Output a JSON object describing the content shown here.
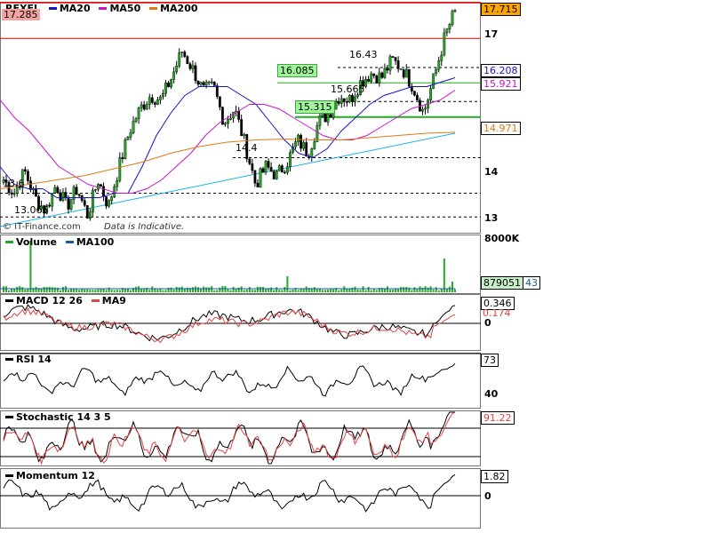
{
  "colors": {
    "ma20": "#1414c8",
    "ma50": "#c814c8",
    "ma200": "#e07814",
    "trendline": "#14b4e6",
    "support": "#22aa22",
    "resistance": "#dd0000",
    "candle_up": "#22aa22",
    "candle_down": "#000000",
    "volume": "#22aa22",
    "macd_signal": "#dd4444"
  },
  "main": {
    "symbol": "REXEL",
    "legend": [
      {
        "name": "MA20",
        "color": "#1414c8"
      },
      {
        "name": "MA50",
        "color": "#c814c8"
      },
      {
        "name": "MA200",
        "color": "#e07814"
      }
    ],
    "top_left_value": "17.285",
    "price_box": "17.715",
    "ma20_box": "16.208",
    "ma50_box": "15.921",
    "ma200_box": "14.971",
    "y_ticks": [
      "17",
      "16",
      "15",
      "14",
      "13"
    ],
    "levels": [
      {
        "text": "16.43",
        "value": 16.43
      },
      {
        "text": "16.085",
        "value": 16.085
      },
      {
        "text": "15.665",
        "value": 15.665
      },
      {
        "text": "15.315",
        "value": 15.315
      },
      {
        "text": "14.4",
        "value": 14.4
      },
      {
        "text": "13.6",
        "value": 13.6
      },
      {
        "text": "13.065",
        "value": 13.065
      }
    ],
    "watermark": "© IT-Finance.com",
    "disclaimer": "Data is Indicative."
  },
  "volume": {
    "legend": [
      {
        "name": "Volume",
        "color": "#22aa22"
      },
      {
        "name": "MA100",
        "color": "#1a5aa0"
      }
    ],
    "scale_label": "8000K",
    "value_box": "879051",
    "ma_box": "43"
  },
  "macd": {
    "legend": [
      {
        "name": "MACD 12 26",
        "color": "#000000"
      },
      {
        "name": "MA9",
        "color": "#dd4444"
      }
    ],
    "value_box": "0.346",
    "signal_box": "0.174",
    "zero_label": "0"
  },
  "rsi": {
    "legend": [
      {
        "name": "RSI 14",
        "color": "#000000"
      }
    ],
    "value_box": "73",
    "level_label": "40"
  },
  "stochastic": {
    "legend": [
      {
        "name": "Stochastic 14 3 5",
        "color": "#000000"
      }
    ],
    "value_box": "91.22"
  },
  "momentum": {
    "legend": [
      {
        "name": "Momentum 12",
        "color": "#000000"
      }
    ],
    "value_box": "1.82",
    "zero_label": "0"
  },
  "chart_data": {
    "type": "candlestick",
    "symbol": "REXEL",
    "y_ticks": [
      13,
      14,
      15,
      16,
      17
    ],
    "y_range": [
      12.75,
      17.75
    ],
    "close_path": [
      13.9,
      13.6,
      14.1,
      13.5,
      13.2,
      13.8,
      13.3,
      13.7,
      13.1,
      13.9,
      13.3,
      14.2,
      15.0,
      15.5,
      15.8,
      15.7,
      16.2,
      16.8,
      16.4,
      15.9,
      16.0,
      15.2,
      15.5,
      14.7,
      13.8,
      14.2,
      14.0,
      14.3,
      14.8,
      14.5,
      15.2,
      15.4,
      15.8,
      15.7,
      16.1,
      16.3,
      16.2,
      16.6,
      16.4,
      16.0,
      15.4,
      16.2,
      17.1,
      17.715
    ],
    "series": [
      {
        "name": "MA20",
        "values": [
          14.2,
          13.8,
          13.7,
          13.7,
          13.5,
          13.5,
          13.5,
          13.5,
          13.6,
          13.6,
          14.2,
          14.9,
          15.4,
          15.8,
          16.0,
          16.0,
          16.0,
          15.8,
          15.6,
          15.2,
          14.8,
          14.5,
          14.4,
          14.6,
          15.0,
          15.3,
          15.6,
          15.8,
          15.9,
          16.0,
          16.0,
          16.1,
          16.2
        ]
      },
      {
        "name": "MA50",
        "values": [
          15.7,
          15.3,
          15.0,
          14.6,
          14.2,
          14.0,
          13.8,
          13.7,
          13.6,
          13.6,
          13.7,
          13.9,
          14.2,
          14.5,
          14.9,
          15.2,
          15.4,
          15.6,
          15.6,
          15.5,
          15.3,
          15.1,
          14.9,
          14.8,
          14.8,
          14.9,
          15.1,
          15.3,
          15.5,
          15.6,
          15.7,
          15.921
        ]
      },
      {
        "name": "MA200",
        "values": [
          13.7,
          13.8,
          13.9,
          14.0,
          14.15,
          14.3,
          14.5,
          14.65,
          14.75,
          14.8,
          14.82,
          14.8,
          14.8,
          14.85,
          14.9,
          14.95,
          14.971
        ]
      }
    ],
    "indicators": {
      "volume_last": 879051,
      "macd": {
        "macd": 0.346,
        "signal": 0.174
      },
      "rsi": 73,
      "stochastic": 91.22,
      "momentum": 1.82
    }
  }
}
